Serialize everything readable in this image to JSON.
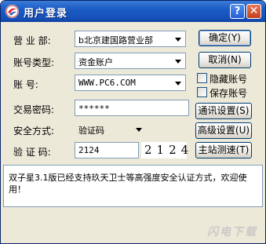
{
  "window": {
    "title": "用户登录",
    "help_button": "?",
    "close_button": "✕",
    "accent_color": "#1c5bc4"
  },
  "form": {
    "branch_label": "营 业 部:",
    "branch_value": "b北京建国路营业部",
    "account_type_label": "账号类型:",
    "account_type_value": "资金账户",
    "account_label": "账      号:",
    "account_value": "WWW.PC6.COM",
    "password_label": "交易密码:",
    "password_value": "******",
    "security_label": "安全方式:",
    "security_value": "验证码",
    "captcha_label": "验 证 码:",
    "captcha_input": "2124",
    "captcha_image": "2124"
  },
  "buttons": {
    "ok": "确定(Y)",
    "ok_key": "Y",
    "cancel": "取消(N)",
    "cancel_key": "N",
    "comm_settings": "通讯设置(S)",
    "comm_key": "S",
    "advanced_settings": "高级设置(U)",
    "advanced_key": "U",
    "speed_test": "主站测速(T)",
    "speed_key": "T"
  },
  "checkboxes": {
    "hide_account": "隐藏账号",
    "save_account": "保存账号"
  },
  "message": "双子星3.1版已经支持玖天卫士等高强度安全认证方式，欢迎使用！",
  "watermark": "闪电下载"
}
